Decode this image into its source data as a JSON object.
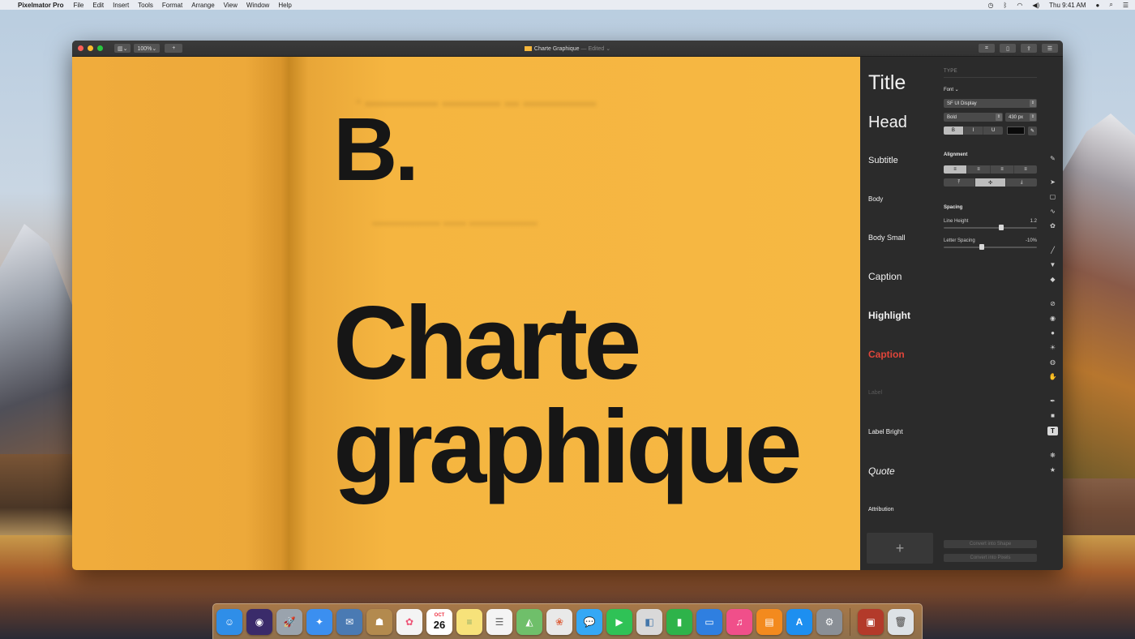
{
  "menubar": {
    "apple": "",
    "app_name": "Pixelmator Pro",
    "menus": [
      "File",
      "Edit",
      "Insert",
      "Tools",
      "Format",
      "Arrange",
      "View",
      "Window",
      "Help"
    ],
    "clock": "Thu 9:41 AM",
    "status_icons": [
      "time-machine-icon",
      "bluetooth-icon",
      "wifi-icon",
      "volume-icon",
      "user-icon",
      "spotlight-icon",
      "notification-center-icon"
    ]
  },
  "window": {
    "title": "Charte Graphique",
    "edited": "— Edited ⌄",
    "zoom": "100%⌄",
    "add_label": "+",
    "view_label": "▥⌄"
  },
  "canvas": {
    "letter": "B.",
    "headline_line1": "Charte",
    "headline_line2": "graphique",
    "background_color": "#f6b843",
    "text_color": "#161616"
  },
  "styles": [
    {
      "label": "Title",
      "color": "#f4f4f4"
    },
    {
      "label": "Head",
      "color": "#f4f4f4"
    },
    {
      "label": "Subtitle",
      "color": "#e6e6e6"
    },
    {
      "label": "Body",
      "color": "#e6e6e6"
    },
    {
      "label": "Body Small",
      "color": "#e6e6e6"
    },
    {
      "label": "Caption",
      "color": "#e6e6e6"
    },
    {
      "label": "Highlight",
      "color": "#ffffff"
    },
    {
      "label": "Caption",
      "color": "#e0453a"
    },
    {
      "label": "Label",
      "color": "#5a5a5a"
    },
    {
      "label": "Label Bright",
      "color": "#e6e6e6"
    },
    {
      "label": "Quote",
      "color": "#e6e6e6"
    },
    {
      "label": "Attribution",
      "color": "#d6d6d6"
    }
  ],
  "add_style_label": "+",
  "inspector": {
    "section": "TYPE",
    "font_label": "Font ⌄",
    "font_family": "SF UI Display",
    "font_weight": "Bold",
    "font_size": "430 px",
    "format_buttons": [
      "B",
      "I",
      "U"
    ],
    "text_color": "#000000",
    "alignment_label": "Alignment",
    "h_align": [
      "≡",
      "≡",
      "≡",
      "≡"
    ],
    "v_align": [
      "⤒",
      "✣",
      "⤓"
    ],
    "spacing_label": "Spacing",
    "line_height_label": "Line Height",
    "line_height_value": "1.2",
    "letter_spacing_label": "Letter Spacing",
    "letter_spacing_value": "-10%",
    "convert_shape": "Convert into Shape",
    "convert_pixels": "Convert into Pixels"
  },
  "tools": [
    {
      "name": "style-tool-icon",
      "glyph": "✎"
    },
    {
      "name": "arrange-tool-icon",
      "glyph": "➤"
    },
    {
      "name": "selection-tool-icon",
      "glyph": "▢"
    },
    {
      "name": "lasso-tool-icon",
      "glyph": "∿"
    },
    {
      "name": "quick-selection-icon",
      "glyph": "✿"
    },
    {
      "name": "paint-brush-icon",
      "glyph": "╱"
    },
    {
      "name": "paint-bucket-icon",
      "glyph": "▼"
    },
    {
      "name": "eraser-icon",
      "glyph": "◆"
    },
    {
      "name": "repair-tool-icon",
      "glyph": "⊘"
    },
    {
      "name": "clone-tool-icon",
      "glyph": "◉"
    },
    {
      "name": "blur-tool-icon",
      "glyph": "●"
    },
    {
      "name": "lighten-tool-icon",
      "glyph": "☀"
    },
    {
      "name": "sponge-tool-icon",
      "glyph": "◍"
    },
    {
      "name": "warp-tool-icon",
      "glyph": "✋"
    },
    {
      "name": "pen-tool-icon",
      "glyph": "✒"
    },
    {
      "name": "shape-tool-icon",
      "glyph": "■"
    },
    {
      "name": "type-tool-icon",
      "glyph": "T"
    },
    {
      "name": "color-adjust-icon",
      "glyph": "❋"
    },
    {
      "name": "effects-icon",
      "glyph": "★"
    }
  ],
  "dock": [
    {
      "name": "finder-icon",
      "glyph": "☺",
      "color": "#2f8ee8"
    },
    {
      "name": "siri-icon",
      "glyph": "◉",
      "color": "#3a2b6a"
    },
    {
      "name": "launchpad-icon",
      "glyph": "🚀",
      "color": "#9aa3ad"
    },
    {
      "name": "safari-icon",
      "glyph": "✦",
      "color": "#3b8ff0"
    },
    {
      "name": "mail-stamp-icon",
      "glyph": "✉",
      "color": "#4a7ab3"
    },
    {
      "name": "contacts-icon",
      "glyph": "☗",
      "color": "#b38a4e"
    },
    {
      "name": "photos-icon",
      "glyph": "✿",
      "color": "#f4f4f4"
    },
    {
      "name": "calendar-icon",
      "glyph": "26",
      "month": "OCT",
      "color": "#ffffff"
    },
    {
      "name": "notes-icon",
      "glyph": "≡",
      "color": "#f7e27a"
    },
    {
      "name": "reminders-icon",
      "glyph": "☰",
      "color": "#f4f4f4"
    },
    {
      "name": "maps-icon",
      "glyph": "◭",
      "color": "#6fbf6a"
    },
    {
      "name": "photos-library-icon",
      "glyph": "❀",
      "color": "#e9e9e9"
    },
    {
      "name": "messages-icon",
      "glyph": "💬",
      "color": "#34a8f5"
    },
    {
      "name": "facetime-icon",
      "glyph": "▶",
      "color": "#2fc256"
    },
    {
      "name": "preview-icon",
      "glyph": "◧",
      "color": "#d9d9d9"
    },
    {
      "name": "numbers-icon",
      "glyph": "▮",
      "color": "#2eb34a"
    },
    {
      "name": "keynote-icon",
      "glyph": "▭",
      "color": "#2f7fe0"
    },
    {
      "name": "itunes-icon",
      "glyph": "♫",
      "color": "#f04f8a"
    },
    {
      "name": "ibooks-icon",
      "glyph": "▤",
      "color": "#f38a1e"
    },
    {
      "name": "app-store-icon",
      "glyph": "A",
      "color": "#1d8ff0"
    },
    {
      "name": "system-preferences-icon",
      "glyph": "⚙",
      "color": "#8a8f96"
    },
    {
      "name": "pixelmator-pro-icon",
      "glyph": "▣",
      "color": "#b33a2a"
    },
    {
      "name": "trash-icon",
      "glyph": "🗑",
      "color": "#dde2e6"
    }
  ]
}
